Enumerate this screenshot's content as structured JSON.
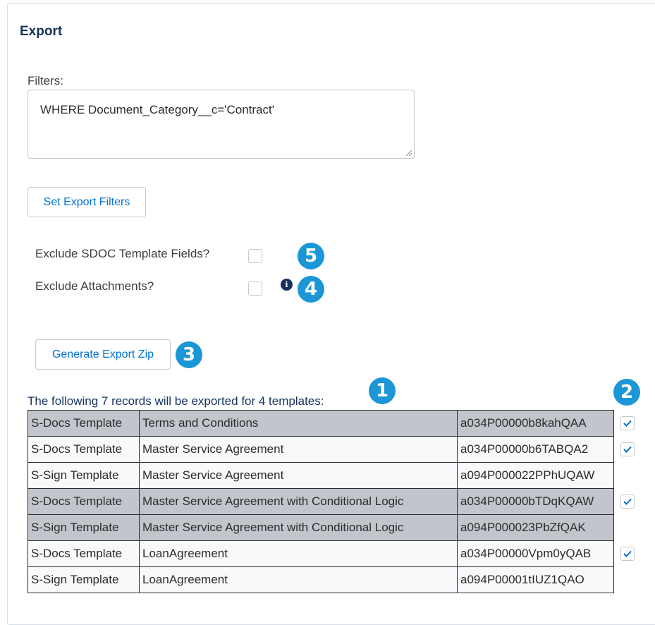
{
  "panel": {
    "title": "Export"
  },
  "filters": {
    "label": "Filters:",
    "value": "WHERE Document_Category__c='Contract'",
    "set_button_label": "Set Export Filters"
  },
  "options": {
    "exclude_fields_label": "Exclude SDOC Template Fields?",
    "exclude_fields_checked": false,
    "exclude_attachments_label": "Exclude Attachments?",
    "exclude_attachments_checked": false,
    "info_icon": "info-icon"
  },
  "generate_button_label": "Generate Export Zip",
  "callouts": {
    "one": "1",
    "two": "2",
    "three": "3",
    "four": "4",
    "five": "5"
  },
  "records_caption": "The following 7 records will be exported for 4 templates:",
  "records": [
    {
      "type": "S-Docs Template",
      "name": "Terms and Conditions",
      "id": "a034P00000b8kahQAA",
      "has_checkbox": true,
      "checked": true
    },
    {
      "type": "S-Docs Template",
      "name": "Master Service Agreement",
      "id": "a034P00000b6TABQA2",
      "has_checkbox": true,
      "checked": true
    },
    {
      "type": "S-Sign Template",
      "name": "Master Service Agreement",
      "id": "a094P000022PPhUQAW",
      "has_checkbox": false,
      "checked": false
    },
    {
      "type": "S-Docs Template",
      "name": "Master Service Agreement with Conditional Logic",
      "id": "a034P00000bTDqKQAW",
      "has_checkbox": true,
      "checked": true
    },
    {
      "type": "S-Sign Template",
      "name": "Master Service Agreement with Conditional Logic",
      "id": "a094P000023PbZfQAK",
      "has_checkbox": false,
      "checked": false
    },
    {
      "type": "S-Docs Template",
      "name": "LoanAgreement",
      "id": "a034P00000Vpm0yQAB",
      "has_checkbox": true,
      "checked": true
    },
    {
      "type": "S-Sign Template",
      "name": "LoanAgreement",
      "id": "a094P00001tIUZ1QAO",
      "has_checkbox": false,
      "checked": false
    }
  ],
  "colors": {
    "accent": "#0070d2",
    "callout": "#1b96d7",
    "title": "#16325c",
    "shaded_row": "#c2c6cc"
  }
}
